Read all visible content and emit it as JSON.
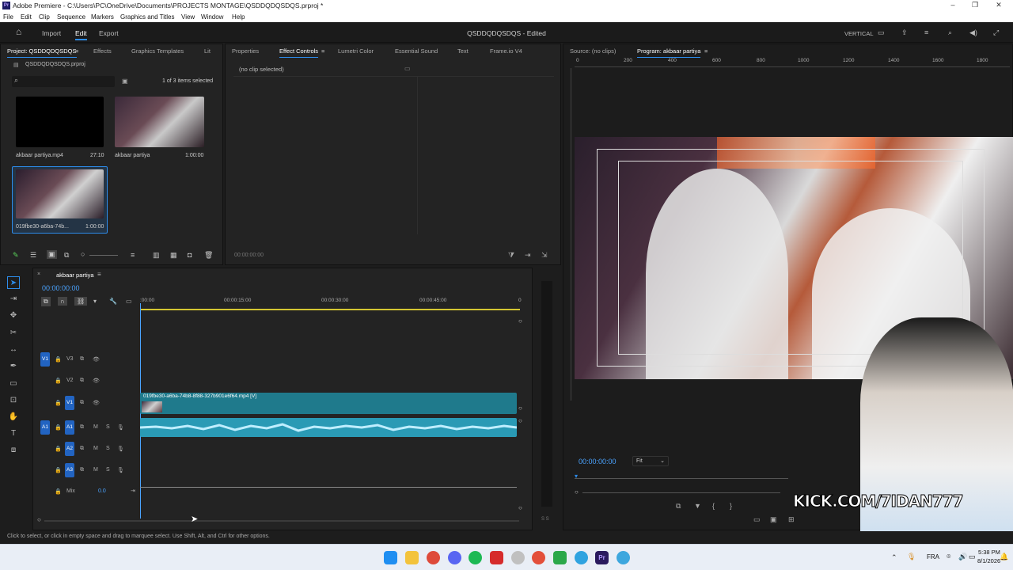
{
  "titlebar": {
    "title": "Adobe Premiere - C:\\Users\\PC\\OneDrive\\Documents\\PROJECTS MONTAGE\\QSDDQDQSDQS.prproj *",
    "icon": "Pr",
    "minimize": "–",
    "maximize": "❐",
    "close": "✕"
  },
  "menu": [
    "File",
    "Edit",
    "Clip",
    "Sequence",
    "Markers",
    "Graphics and Titles",
    "View",
    "Window",
    "Help"
  ],
  "header": {
    "home": "⌂",
    "nav": [
      "Import",
      "Edit",
      "Export"
    ],
    "project_title": "QSDDQDQSDQS - Edited",
    "workspace": "VERTICAL"
  },
  "project_panel": {
    "tabs": [
      "Project: QSDDQDQSDQS",
      "Effects",
      "Graphics Templates",
      "Lit"
    ],
    "file": "QSDDQDQSDQS.prproj",
    "search_placeholder": "",
    "selection_count": "1 of 3 items selected",
    "items": [
      {
        "name": "akbaar partiya.mp4",
        "duration": "27:10"
      },
      {
        "name": "akbaar partiya",
        "duration": "1:00:00"
      },
      {
        "name": "019fbe30-a6ba-74b...",
        "duration": "1:00:00"
      }
    ]
  },
  "effect_panel": {
    "tabs": [
      "Properties",
      "Effect Controls",
      "Lumetri Color",
      "Essential Sound",
      "Text",
      "Frame.io V4"
    ],
    "no_clip": "(no clip selected)",
    "timecode": "00:00:00:00"
  },
  "monitor": {
    "source_tab": "Source: (no clips)",
    "program_tab": "Program: akbaar partiya",
    "ruler": [
      "0",
      "200",
      "400",
      "600",
      "800",
      "1000",
      "1200",
      "1400",
      "1600",
      "1800"
    ],
    "timecode": "00:00:00:00",
    "fit": "Fit",
    "overlay_text": "KICK.COM/7IDAN777"
  },
  "timeline": {
    "sequence_name": "akbaar partiya",
    "timecode": "00:00:00:00",
    "ruler": [
      ":00:00",
      "00:00:15:00",
      "00:00:30:00",
      "00:00:45:00",
      "0"
    ],
    "video_tracks": [
      {
        "src": "V1",
        "label": "V3"
      },
      {
        "src": "",
        "label": "V2"
      },
      {
        "src": "",
        "label": "V1"
      }
    ],
    "audio_tracks": [
      {
        "src": "A1",
        "label": "A1"
      },
      {
        "src": "",
        "label": "A2"
      },
      {
        "src": "",
        "label": "A3"
      }
    ],
    "mix_label": "Mix",
    "mix_value": "0.0",
    "clip_name": "019fbe30-a6ba-74b8-8f88-327b901e6f64.mp4 [V]"
  },
  "status": {
    "text": "Click to select, or click in empty space and drag to marquee select. Use Shift, Alt, and Ctrl for other options."
  },
  "taskbar": {
    "lang": "FRA",
    "time": "5:38 PM",
    "date": "8/1/2026"
  },
  "colors": {
    "accent": "#2d8ceb",
    "track_blue": "#2264c2",
    "clip_video": "#1f7a8c",
    "clip_audio": "#2a9ab5",
    "playhead": "#2d8ceb"
  }
}
